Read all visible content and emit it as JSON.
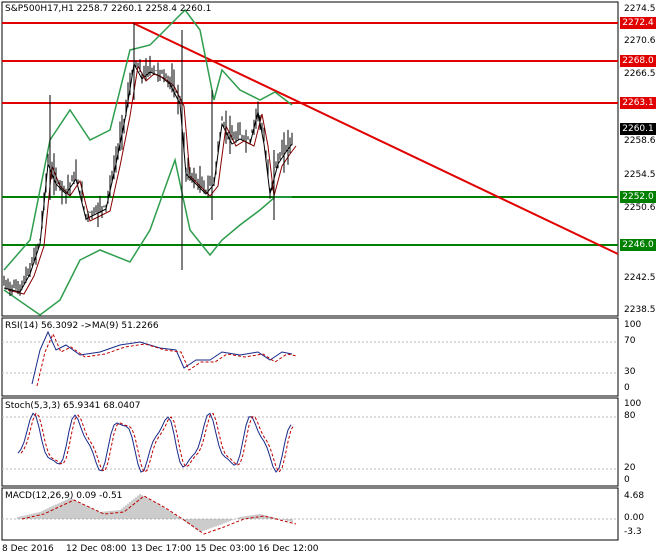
{
  "header": {
    "symbol_info": "S&P500H17,H1  2258.7 2260.1 2258.4 2260.1"
  },
  "price_axis": {
    "ticks": [
      "2274.5",
      "2270.6",
      "2266.5",
      "2262.6",
      "2258.6",
      "2254.5",
      "2250.6",
      "2246.6",
      "2242.5",
      "2238.5"
    ]
  },
  "price_labels": [
    {
      "value": "2272.4",
      "color": "#e00000"
    },
    {
      "value": "2268.0",
      "color": "#e00000"
    },
    {
      "value": "2263.1",
      "color": "#e00000"
    },
    {
      "value": "2260.1",
      "color": "#000000"
    },
    {
      "value": "2252.0",
      "color": "#008000"
    },
    {
      "value": "2246.0",
      "color": "#008000"
    }
  ],
  "rsi": {
    "label": "RSI(14) 56.3092  ->MA(9) 51.2266",
    "ticks": [
      "100",
      "70",
      "30",
      "0"
    ]
  },
  "stoch": {
    "label": "Stoch(5,3,3) 65.9341 68.0407",
    "ticks": [
      "100",
      "80",
      "20",
      "0"
    ]
  },
  "macd": {
    "label": "MACD(12,26,9) 0.09 -0.51",
    "ticks": [
      "4.68",
      "0.00",
      "-3.3"
    ]
  },
  "time_axis": [
    "8 Dec 2016",
    "12 Dec 08:00",
    "13 Dec 17:00",
    "15 Dec 03:00",
    "16 Dec 12:00"
  ],
  "colors": {
    "resistance": "#e00000",
    "support": "#008000",
    "bands": "#2e9d4d",
    "candle": "#000000",
    "ma": "#8b0000"
  }
}
